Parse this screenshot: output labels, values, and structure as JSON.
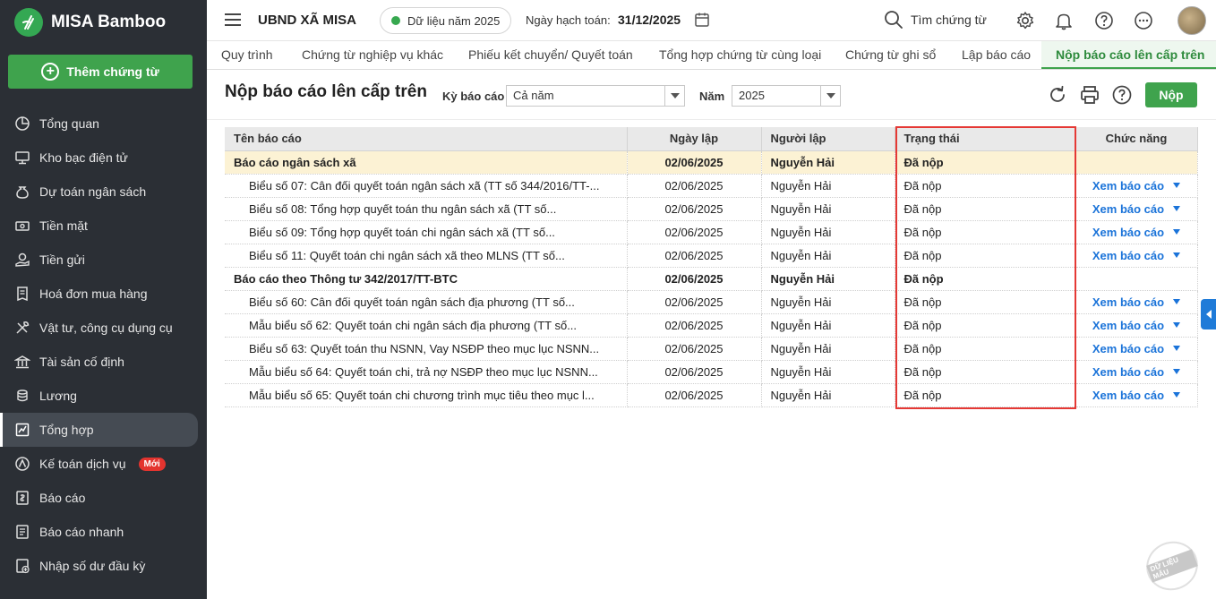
{
  "app": {
    "name": "MISA Bamboo"
  },
  "sidebar": {
    "add_label": "Thêm chứng từ",
    "items": [
      {
        "label": "Tổng quan",
        "icon": "pie-chart-icon"
      },
      {
        "label": "Kho bạc điện tử",
        "icon": "monitor-icon"
      },
      {
        "label": "Dự toán ngân sách",
        "icon": "money-bag-icon"
      },
      {
        "label": "Tiền mặt",
        "icon": "cash-icon"
      },
      {
        "label": "Tiền gửi",
        "icon": "deposit-icon"
      },
      {
        "label": "Hoá đơn mua hàng",
        "icon": "invoice-icon"
      },
      {
        "label": "Vật tư, công cụ dụng cụ",
        "icon": "tools-icon"
      },
      {
        "label": "Tài sản cố định",
        "icon": "bank-icon"
      },
      {
        "label": "Lương",
        "icon": "coin-stack-icon"
      },
      {
        "label": "Tổng hợp",
        "icon": "summary-icon"
      },
      {
        "label": "Kế toán dịch vụ",
        "icon": "service-icon",
        "badge": "Mới"
      },
      {
        "label": "Báo cáo",
        "icon": "report-icon"
      },
      {
        "label": "Báo cáo nhanh",
        "icon": "quick-report-icon"
      },
      {
        "label": "Nhập số dư đầu kỳ",
        "icon": "import-icon"
      }
    ],
    "active_index": 9
  },
  "topbar": {
    "org": "UBND XÃ MISA",
    "data_year": "Dữ liệu năm 2025",
    "accounting_date_label": "Ngày hạch toán:",
    "accounting_date": "31/12/2025",
    "search_label": "Tìm chứng từ"
  },
  "tabs": [
    "Quy trình",
    "Chứng từ nghiệp vụ khác",
    "Phiếu kết chuyển/ Quyết toán",
    "Tổng hợp chứng từ cùng loại",
    "Chứng từ ghi sổ",
    "Lập báo cáo",
    "Nộp báo cáo lên cấp trên"
  ],
  "page": {
    "title": "Nộp báo cáo lên cấp trên",
    "period_label": "Kỳ báo cáo",
    "period_value": "Cả năm",
    "year_label": "Năm",
    "year_value": "2025",
    "submit_label": "Nộp"
  },
  "table": {
    "columns": [
      "Tên báo cáo",
      "Ngày lập",
      "Người lập",
      "Trạng thái",
      "Chức năng"
    ],
    "action_label": "Xem báo cáo",
    "rows": [
      {
        "type": "group",
        "name": "Báo cáo ngân sách xã",
        "date": "02/06/2025",
        "by": "Nguyễn Hải",
        "status": "Đã nộp",
        "highlight": true
      },
      {
        "type": "child",
        "name": "Biểu số 07: Cân đối quyết toán ngân sách xã (TT số 344/2016/TT-...",
        "date": "02/06/2025",
        "by": "Nguyễn Hải",
        "status": "Đã nộp"
      },
      {
        "type": "child",
        "name": "Biểu số 08: Tổng hợp quyết toán thu ngân sách xã (TT số...",
        "date": "02/06/2025",
        "by": "Nguyễn Hải",
        "status": "Đã nộp"
      },
      {
        "type": "child",
        "name": "Biểu số 09: Tổng hợp quyết toán chi ngân sách xã (TT số...",
        "date": "02/06/2025",
        "by": "Nguyễn Hải",
        "status": "Đã nộp"
      },
      {
        "type": "child",
        "name": "Biểu số 11: Quyết toán chi ngân sách xã theo MLNS (TT số...",
        "date": "02/06/2025",
        "by": "Nguyễn Hải",
        "status": "Đã nộp"
      },
      {
        "type": "group",
        "name": "Báo cáo theo Thông tư 342/2017/TT-BTC",
        "date": "02/06/2025",
        "by": "Nguyễn Hải",
        "status": "Đã nộp",
        "highlight": false
      },
      {
        "type": "child",
        "name": "Biểu số 60: Cân đối quyết toán ngân sách địa phương (TT số...",
        "date": "02/06/2025",
        "by": "Nguyễn Hải",
        "status": "Đã nộp"
      },
      {
        "type": "child",
        "name": "Mẫu biểu số 62: Quyết toán chi ngân sách địa phương (TT số...",
        "date": "02/06/2025",
        "by": "Nguyễn Hải",
        "status": "Đã nộp"
      },
      {
        "type": "child",
        "name": "Biểu số 63: Quyết toán thu NSNN, Vay NSĐP theo mục lục NSNN...",
        "date": "02/06/2025",
        "by": "Nguyễn Hải",
        "status": "Đã nộp"
      },
      {
        "type": "child",
        "name": "Mẫu biểu số 64: Quyết toán chi, trả nợ NSĐP theo mục lục NSNN...",
        "date": "02/06/2025",
        "by": "Nguyễn Hải",
        "status": "Đã nộp"
      },
      {
        "type": "child",
        "name": "Mẫu biểu số 65: Quyết toán chi chương trình mục tiêu theo mục l...",
        "date": "02/06/2025",
        "by": "Nguyễn Hải",
        "status": "Đã nộp"
      }
    ]
  },
  "watermark": "DỮ LIỆU MẪU",
  "colors": {
    "accent": "#3fa34d",
    "sidebar_bg": "#2b2f35",
    "link": "#1a73d9",
    "highlight_row": "#fcf2d4",
    "status_outline": "#e53935"
  }
}
